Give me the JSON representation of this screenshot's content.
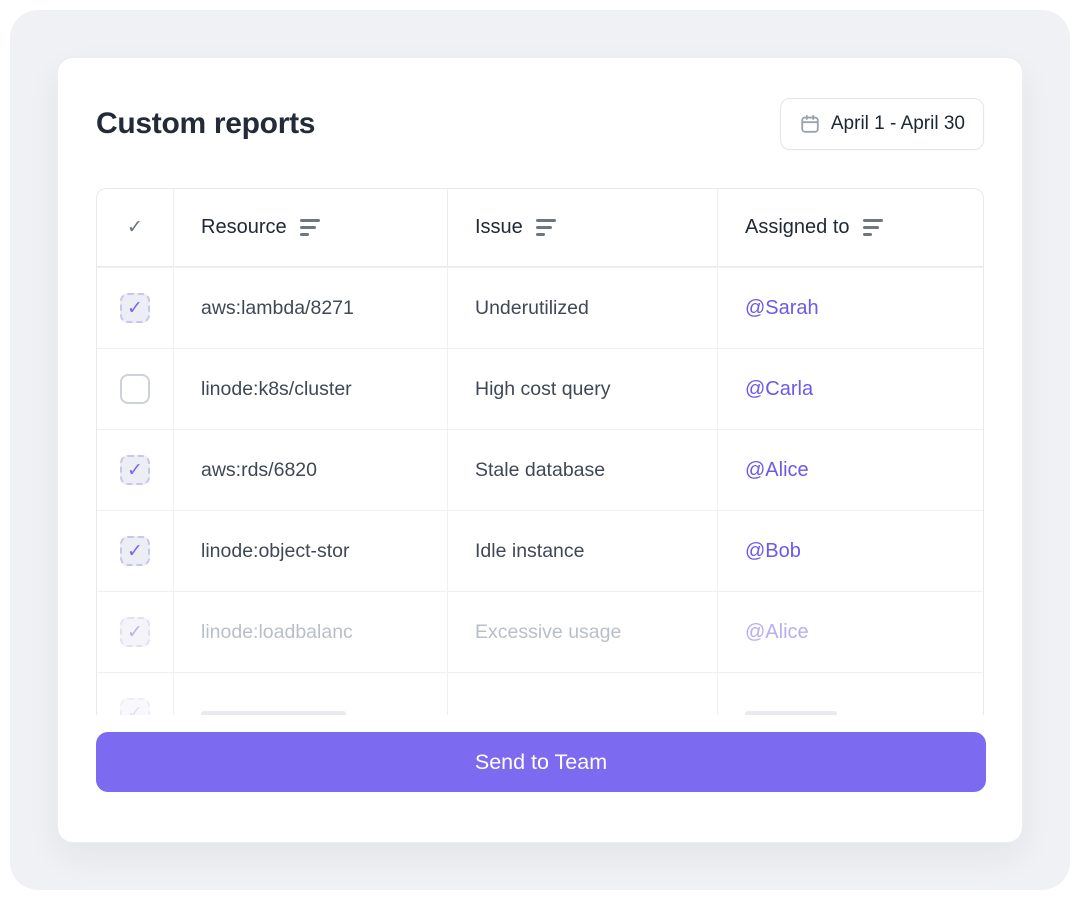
{
  "header": {
    "title": "Custom reports",
    "date_range": "April 1 - April 30"
  },
  "table": {
    "columns": [
      {
        "label": "✓"
      },
      {
        "label": "Resource"
      },
      {
        "label": "Issue"
      },
      {
        "label": "Assigned to"
      }
    ],
    "rows": [
      {
        "checked": true,
        "resource": "aws:lambda/8271",
        "issue": "Underutilized",
        "assigned": "@Sarah"
      },
      {
        "checked": false,
        "resource": "linode:k8s/cluster",
        "issue": "High cost query",
        "assigned": "@Carla"
      },
      {
        "checked": true,
        "resource": "aws:rds/6820",
        "issue": "Stale database",
        "assigned": "@Alice"
      },
      {
        "checked": true,
        "resource": "linode:object-stor",
        "issue": "Idle instance",
        "assigned": "@Bob"
      },
      {
        "checked": true,
        "resource": "linode:loadbalanc",
        "issue": "Excessive usage",
        "assigned": "@Alice"
      }
    ]
  },
  "icons": {
    "check": "✓"
  },
  "footer": {
    "send_button_label": "Send to Team"
  },
  "colors": {
    "accent": "#7c6af0",
    "link": "#6c59ea",
    "faded_link": "#b8aef2",
    "title": "#242b38",
    "frame_bg": "#f0f1f4"
  }
}
